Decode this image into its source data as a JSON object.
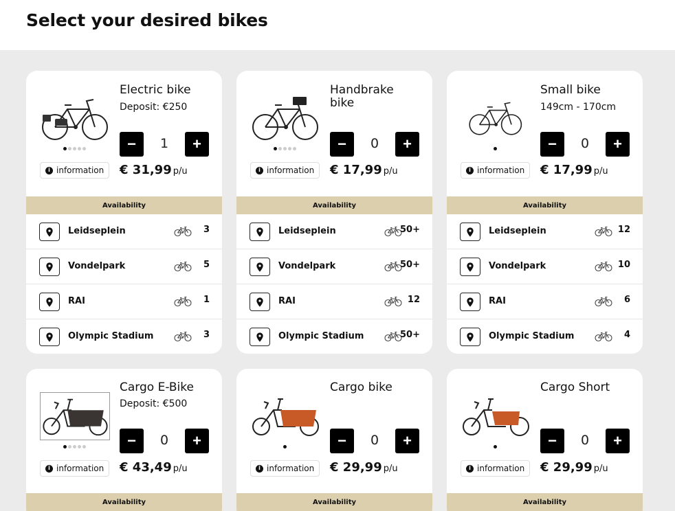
{
  "page": {
    "title": "Select your desired bikes"
  },
  "labels": {
    "information": "information",
    "availability": "Availability",
    "currency": "€",
    "per_unit": "p/u",
    "minus": "−",
    "plus": "+"
  },
  "colors": {
    "availability_bar": "#dccfae",
    "page_bg": "#ebebeb",
    "stepper": "#000000",
    "cargo_box": "#c85a28"
  },
  "bikes": [
    {
      "name": "Electric bike",
      "subtitle": "Deposit: €250",
      "quantity": "1",
      "price": "€ 31,99",
      "icon": "electric-bike-image",
      "locations": [
        {
          "name": "Leidseplein",
          "count": "3"
        },
        {
          "name": "Vondelpark",
          "count": "5"
        },
        {
          "name": "RAI",
          "count": "1"
        },
        {
          "name": "Olympic Stadium",
          "count": "3"
        }
      ]
    },
    {
      "name": "Handbrake bike",
      "subtitle": "",
      "quantity": "0",
      "price": "€ 17,99",
      "icon": "handbrake-bike-image",
      "locations": [
        {
          "name": "Leidseplein",
          "count": "50+"
        },
        {
          "name": "Vondelpark",
          "count": "50+"
        },
        {
          "name": "RAI",
          "count": "12"
        },
        {
          "name": "Olympic Stadium",
          "count": "50+"
        }
      ]
    },
    {
      "name": "Small bike",
      "subtitle": "149cm - 170cm",
      "quantity": "0",
      "price": "€ 17,99",
      "icon": "small-bike-image",
      "locations": [
        {
          "name": "Leidseplein",
          "count": "12"
        },
        {
          "name": "Vondelpark",
          "count": "10"
        },
        {
          "name": "RAI",
          "count": "6"
        },
        {
          "name": "Olympic Stadium",
          "count": "4"
        }
      ]
    },
    {
      "name": "Cargo E-Bike",
      "subtitle": "Deposit: €500",
      "quantity": "0",
      "price": "€ 43,49",
      "icon": "cargo-e-bike-image"
    },
    {
      "name": "Cargo bike",
      "subtitle": "",
      "quantity": "0",
      "price": "€ 29,99",
      "icon": "cargo-bike-image"
    },
    {
      "name": "Cargo Short",
      "subtitle": "",
      "quantity": "0",
      "price": "€ 29,99",
      "icon": "cargo-short-image"
    }
  ]
}
